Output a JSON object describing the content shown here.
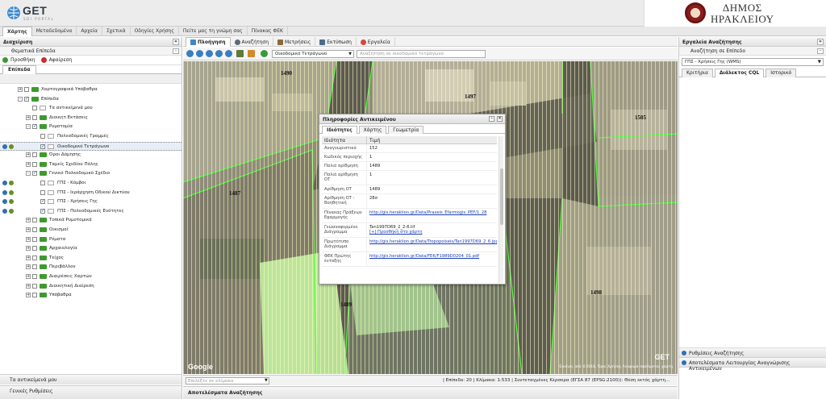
{
  "header": {
    "logo_text": "GET",
    "logo_sub": "SDI PORTAL",
    "brand_line1": "ΔΗΜΟΣ",
    "brand_line2": "ΗΡΑΚΛΕΙΟΥ"
  },
  "topnav": {
    "tabs": [
      "Χάρτης",
      "Μεταδεδομένα",
      "Αρχεία",
      "Σχετικά",
      "Οδηγίες Χρήσης",
      "Πείτε μας τη γνώμη σας",
      "Πίνακας ΦΕΚ"
    ],
    "active": "Χάρτης"
  },
  "left": {
    "title": "Διαχείριση",
    "sub_title": "Θεματικά Επίπεδα",
    "add_label": "Προσθήκη",
    "remove_label": "Αφαίρεση",
    "tab": "Επίπεδα",
    "tree": [
      {
        "label": "Χαρτογραφικά Υπόβαθρα",
        "level": 1,
        "type": "folder",
        "checked": false,
        "expander": "+"
      },
      {
        "label": "Επίπεδα",
        "level": 1,
        "type": "folder",
        "checked": true,
        "expander": "-"
      },
      {
        "label": "Τα αντικείμενά μου",
        "level": 2,
        "type": "layer",
        "checked": false
      },
      {
        "label": "Διοικητ.Εκτάσεις",
        "level": 2,
        "type": "folder",
        "checked": false,
        "expander": "+"
      },
      {
        "label": "Ρυμοτομία",
        "level": 2,
        "type": "folder",
        "checked": true,
        "expander": "-"
      },
      {
        "label": "Πολεοδομικές Γραμμές",
        "level": 3,
        "type": "layer",
        "checked": false
      },
      {
        "label": "Οικοδομικό Τετράγωνο",
        "level": 3,
        "type": "layer",
        "checked": true,
        "selected": true,
        "icons": true
      },
      {
        "label": "Όροι Δόμησης",
        "level": 2,
        "type": "folder",
        "checked": false,
        "expander": "+"
      },
      {
        "label": "Ταμείς Σχεδίου Πόλης",
        "level": 2,
        "type": "folder",
        "checked": false,
        "expander": "+"
      },
      {
        "label": "Γενικό Πολεοδομικό Σχέδιο",
        "level": 2,
        "type": "folder",
        "checked": true,
        "expander": "-"
      },
      {
        "label": "ΓΠΣ - Κόμβοι",
        "level": 3,
        "type": "layer",
        "checked": false,
        "icons": true
      },
      {
        "label": "ΓΠΣ - Ιεράρχηση Οδικού Δικτύου",
        "level": 3,
        "type": "layer",
        "checked": false,
        "icons": true
      },
      {
        "label": "ΓΠΣ - Χρήσεις Γης",
        "level": 3,
        "type": "layer",
        "checked": true,
        "icons": true
      },
      {
        "label": "ΓΠΣ - Πολεοδομικές Ενότητες",
        "level": 3,
        "type": "layer",
        "checked": true,
        "icons": true
      },
      {
        "label": "Τοπικά Ρυμοτομικά",
        "level": 2,
        "type": "folder",
        "checked": false,
        "expander": "+"
      },
      {
        "label": "Οικισμοί",
        "level": 2,
        "type": "folder",
        "checked": false,
        "expander": "+"
      },
      {
        "label": "Ρέματα",
        "level": 2,
        "type": "folder",
        "checked": false,
        "expander": "+"
      },
      {
        "label": "Αρχαιολογία",
        "level": 2,
        "type": "folder",
        "checked": false,
        "expander": "+"
      },
      {
        "label": "Τείχος",
        "level": 2,
        "type": "folder",
        "checked": false,
        "expander": "+"
      },
      {
        "label": "Περιβάλλον",
        "level": 2,
        "type": "folder",
        "checked": false,
        "expander": "+"
      },
      {
        "label": "Διαιρέσεις Χαρτών",
        "level": 2,
        "type": "folder",
        "checked": false,
        "expander": "+"
      },
      {
        "label": "Διοικητική Διαίρεση",
        "level": 2,
        "type": "folder",
        "checked": false,
        "expander": "+"
      },
      {
        "label": "Υπόβαθρα",
        "level": 2,
        "type": "folder",
        "checked": false,
        "expander": "+"
      }
    ],
    "bottom1": "Τα αντικείμενά μου",
    "bottom2": "Γενικές Ρυθμίσεις"
  },
  "maptoolbar": {
    "tabs": [
      "Πλοήγηση",
      "Αναζήτηση",
      "Μετρήσεις",
      "Εκτύπωση",
      "Εργαλεία"
    ],
    "active": "Πλοήγηση",
    "layer_select": "Οικοδομικό Τετράγωνο",
    "search_placeholder": "Αναζήτηση σε οικοδομικό τετράγωνο"
  },
  "map": {
    "block_labels": [
      "1490",
      "1497",
      "1505",
      "1487",
      "1498",
      "1489"
    ],
    "attribution": "Εικόνες από ©2018, Όροι Χρήσης Αναφορά σφάλματος χάρτη",
    "google": "Google",
    "watermark": "GET"
  },
  "popup": {
    "title": "Πληροφορίες Αντικειμένου",
    "tabs": [
      "Ιδιότητες",
      "Χάρτης",
      "Γεωμετρία"
    ],
    "active_tab": "Ιδιότητες",
    "col_key": "Ιδιότητα",
    "col_val": "Τιμή",
    "rows": [
      {
        "k": "Αναγνωριστικό",
        "v": "152",
        "link": false
      },
      {
        "k": "Κωδικός περιοχής",
        "v": "1",
        "link": false
      },
      {
        "k": "Παλιό αρίθμηση",
        "v": "1489",
        "link": false
      },
      {
        "k": "Παλιό αρίθμηση ΟΤ",
        "v": "1",
        "link": false
      },
      {
        "k": "Αρίθμηση ΟΤ",
        "v": "1489",
        "link": false
      },
      {
        "k": "Αρίθμηση ΟΤ - Βοηθητική",
        "v": "28σ",
        "link": false
      },
      {
        "k": "Πίνακας Πράξεων Εφαρμογής",
        "v": "http://gis.heraklion.gr/Data/Praxeis_Efarmogis_PEF/1_28",
        "link": true
      },
      {
        "k": "Γεωαναφερμένο Διάγραμμα",
        "v": "Tan1997D69_2_2-6.tif",
        "v2": "[+] Προσθήκη στο χάρτη",
        "link": false
      },
      {
        "k": "Πρωτότυπο Διάγραμμα",
        "v": "http://gis.heraklion.gr/Data/Tropopoiseis/Tan1997D69_2_6.jpg",
        "link": true
      },
      {
        "k": "ΦΕΚ Πρώτης ένταξης",
        "v": "http://gis.heraklion.gr/Data/FEK/F1989D0204_01.pdf",
        "link": true
      }
    ]
  },
  "statusbar": {
    "placeholder": "Επιλέξτε σε κλίμακα",
    "info": "| Επίπεδο: 20 | Κλίμακα: 1:533 | Συντεταγμένες Κέρσορα (ΕΓΣΑ 87 (EPSG:2100)): Θέση εκτός χάρτη..."
  },
  "results_title": "Αποτελέσματα Αναζήτησης",
  "right": {
    "title": "Εργαλεία Αναζήτησης",
    "sub_title": "Αναζήτηση σε Επίπεδο",
    "select": "ΓΠΣ - Χρήσεις Γης (WMS)",
    "tabs": [
      "Κριτήρια",
      "Διάλεκτος CQL",
      "Ιστορικό"
    ],
    "active_tab": "Διάλεκτος CQL",
    "footer1": "Ρυθμίσεις Αναζήτησης",
    "footer2": "Αποτελέσματα Λειτουργίας Αναγνώρισης Αντικειμένων"
  },
  "colors": {
    "accent": "#2f6fb5",
    "folder": "#3e9a2d",
    "parcel_outline": "#4cff3a",
    "selected_fill": "#c6f7a6"
  }
}
